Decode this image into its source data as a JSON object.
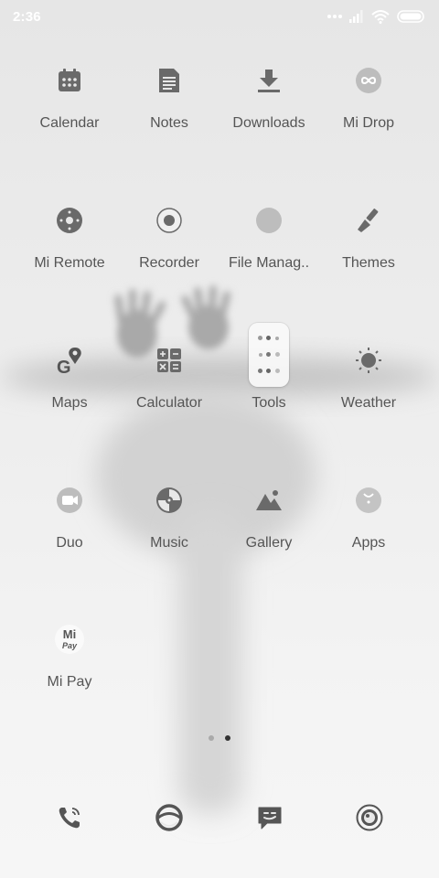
{
  "status_bar": {
    "time": "2:36",
    "icons": [
      "signal-dots-icon",
      "cellular-signal-icon",
      "wifi-icon",
      "battery-icon"
    ]
  },
  "apps": [
    {
      "label": "Calendar",
      "icon": "calendar-icon"
    },
    {
      "label": "Notes",
      "icon": "notes-icon"
    },
    {
      "label": "Downloads",
      "icon": "download-icon"
    },
    {
      "label": "Mi Drop",
      "icon": "infinity-icon"
    },
    {
      "label": "Mi Remote",
      "icon": "remote-icon"
    },
    {
      "label": "Recorder",
      "icon": "record-icon"
    },
    {
      "label": "File Manag..",
      "icon": "folder-icon"
    },
    {
      "label": "Themes",
      "icon": "brush-icon"
    },
    {
      "label": "Maps",
      "icon": "maps-icon"
    },
    {
      "label": "Calculator",
      "icon": "calculator-icon"
    },
    {
      "label": "Tools",
      "icon": "folder-grid-icon"
    },
    {
      "label": "Weather",
      "icon": "sun-icon"
    },
    {
      "label": "Duo",
      "icon": "video-camera-icon"
    },
    {
      "label": "Music",
      "icon": "disc-icon"
    },
    {
      "label": "Gallery",
      "icon": "mountain-icon"
    },
    {
      "label": "Apps",
      "icon": "store-bag-icon"
    },
    {
      "label": "Mi Pay",
      "icon": "mi-pay-icon"
    }
  ],
  "mipay_logo": {
    "line1": "Mi",
    "line2": "Pay"
  },
  "pages": {
    "count": 2,
    "current": 2
  },
  "dock": [
    {
      "icon": "phone-icon"
    },
    {
      "icon": "browser-icon"
    },
    {
      "icon": "message-icon"
    },
    {
      "icon": "camera-icon"
    }
  ],
  "colors": {
    "icon": "#6a6a6a",
    "label": "#555555",
    "status_text": "#ffffff",
    "dot_active": "#333333",
    "dot_inactive": "#aaaaaa"
  }
}
